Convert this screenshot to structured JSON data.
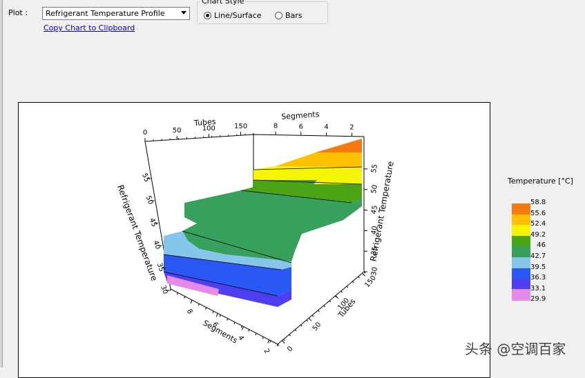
{
  "controls": {
    "plot_label": "Plot :",
    "plot_value": "Refrigerant Temperature Profile",
    "copy_link": "Copy Chart to Clipboard",
    "chart_style_title": "Chart Style",
    "radio_line": "Line/Surface",
    "radio_bars": "Bars",
    "selected": "Line/Surface"
  },
  "chart": {
    "z_axis_label": "Refrigerant Temperature",
    "right_axis_label": "Refrigerant Temperature",
    "tubes_label": "Tubes",
    "segments_label": "Segments",
    "top_tubes_ticks": [
      "0",
      "50",
      "100",
      "150"
    ],
    "top_segments_ticks": [
      "8",
      "6",
      "4",
      "2"
    ],
    "left_z_ticks": [
      "30",
      "35",
      "40",
      "45",
      "50",
      "55"
    ],
    "right_z_ticks": [
      "30",
      "35",
      "40",
      "45",
      "50",
      "55"
    ],
    "bottom_segments_ticks": [
      "8",
      "6",
      "4",
      "2"
    ],
    "bottom_tubes_ticks": [
      "150",
      "100",
      "50",
      "0"
    ]
  },
  "chart_data": {
    "type": "heatmap",
    "title": "",
    "legend_title": "Temperature [°C]",
    "legend_placement": "right",
    "levels": [
      "58.8",
      "55.6",
      "52.4",
      "49.2",
      "46",
      "42.7",
      "39.5",
      "36.3",
      "33.1",
      "29.9"
    ],
    "colors": [
      "#f57a0f",
      "#ffc000",
      "#f5f500",
      "#4aa416",
      "#36a05c",
      "#85c6ea",
      "#2b57f5",
      "#4d3ff0",
      "#e58ae8",
      "#ffffff"
    ],
    "x_axis": "Tubes",
    "y_axis": "Segments",
    "z_axis": "Refrigerant Temperature",
    "z_range": [
      30,
      58
    ]
  },
  "watermark": "头条 @空调百家"
}
